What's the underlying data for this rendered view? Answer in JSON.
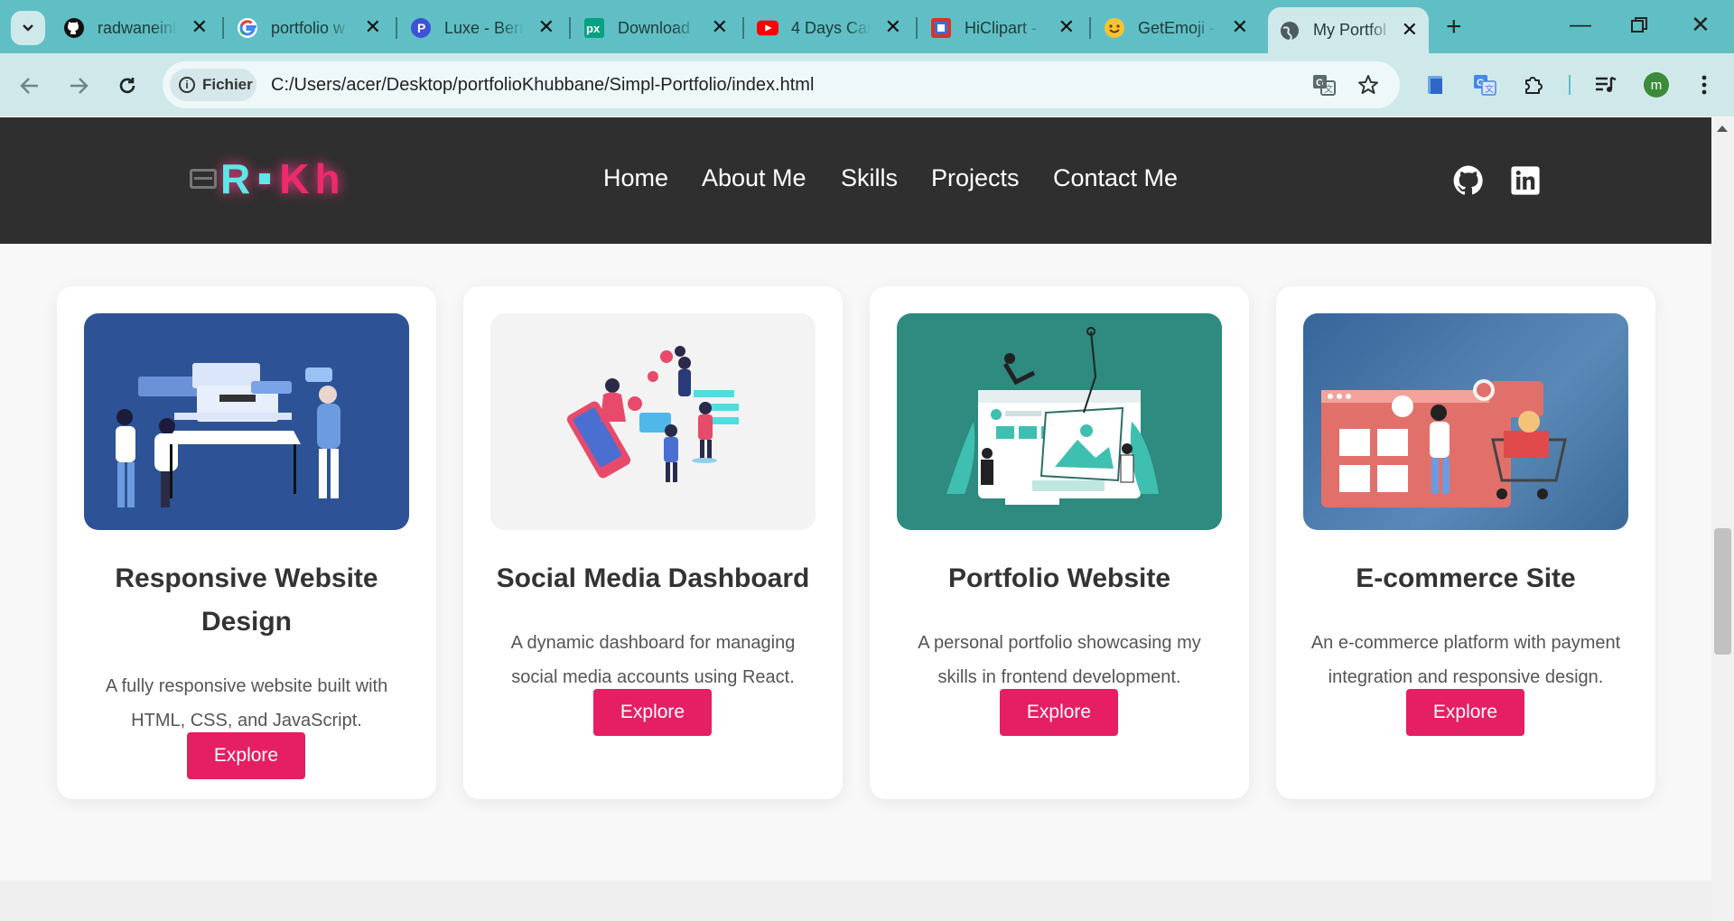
{
  "browser": {
    "tabs": [
      {
        "title": "radwaneinl",
        "icon": "github-icon"
      },
      {
        "title": "portfolio w",
        "icon": "google-icon"
      },
      {
        "title": "Luxe - Berr",
        "icon": "p-logo-icon"
      },
      {
        "title": "Download",
        "icon": "pexels-icon"
      },
      {
        "title": "4 Days Car",
        "icon": "youtube-icon"
      },
      {
        "title": "HiClipart -",
        "icon": "hiclipart-icon"
      },
      {
        "title": "GetEmoji -",
        "icon": "emoji-icon"
      },
      {
        "title": "My Portfol",
        "icon": "globe-icon",
        "active": true
      }
    ],
    "security_chip": "Fichier",
    "url": "C:/Users/acer/Desktop/portfolioKhubbane/Simpl-Portfolio/index.html",
    "profile_initial": "m",
    "accent": "#5fbfc4"
  },
  "site": {
    "logo": {
      "left": "R",
      "right": "Kh"
    },
    "nav": [
      "Home",
      "About Me",
      "Skills",
      "Projects",
      "Contact Me"
    ],
    "social": [
      "github-icon",
      "linkedin-icon"
    ],
    "button_color": "#e61e63"
  },
  "projects": [
    {
      "title": "Responsive Website Design",
      "description": "A fully responsive website built with HTML, CSS, and JavaScript.",
      "button": "Explore",
      "image_bg": "#2d5396"
    },
    {
      "title": "Social Media Dashboard",
      "description": "A dynamic dashboard for managing social media accounts using React.",
      "button": "Explore",
      "image_bg": "#f3f3f3"
    },
    {
      "title": "Portfolio Website",
      "description": "A personal portfolio showcasing my skills in frontend development.",
      "button": "Explore",
      "image_bg": "#2f8a80"
    },
    {
      "title": "E-commerce Site",
      "description": "An e-commerce platform with payment integration and responsive design.",
      "button": "Explore",
      "image_bg": "#3c6a98"
    }
  ]
}
